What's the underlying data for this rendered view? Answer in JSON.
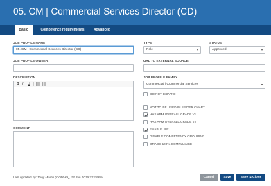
{
  "header": {
    "title": "05. CM | Commercial Services Director (CD)"
  },
  "tabs": [
    {
      "label": "Basic",
      "active": true
    },
    {
      "label": "Competence requirements",
      "active": false
    },
    {
      "label": "Advanced",
      "active": false
    }
  ],
  "form": {
    "job_profile_name": {
      "label": "JOB PROFILE NAME",
      "value": "05. CM | Commercial Services Director (CD)"
    },
    "type": {
      "label": "TYPE",
      "value": "Role"
    },
    "status": {
      "label": "STATUS",
      "value": "Approved"
    },
    "job_profile_owner": {
      "label": "JOB PROFILE OWNER",
      "value": ""
    },
    "url_external": {
      "label": "URL TO EXTERNAL SOURCE",
      "value": ""
    },
    "description": {
      "label": "DESCRIPTION"
    },
    "job_profile_family": {
      "label": "JOB PROFILE FAMILY",
      "value": "Commercial | Commercial Services"
    },
    "comment": {
      "label": "COMMENT"
    }
  },
  "editor_toolbar": {
    "bold": "B",
    "italic": "I",
    "underline": "U"
  },
  "checkboxes": [
    {
      "label": "DO NOT EXPAND",
      "checked": false
    },
    {
      "label": "NOT TO BE USED IN SPIDER CHART",
      "checked": false
    },
    {
      "label": "HAS APM OVERALL GRADE V1",
      "checked": true
    },
    {
      "label": "HAS APM OVERALL GRADE V2",
      "checked": false
    },
    {
      "label": "ENABLE JLR",
      "checked": true
    },
    {
      "label": "DISABLE COMPETENCY GROUPING",
      "checked": false
    },
    {
      "label": "GRADE 100% COMPLIANCE",
      "checked": false
    }
  ],
  "footer": {
    "last_updated_label": "Last updated by:",
    "last_updated_value": "Tony Martin (COMMA), 13 Jan 2019 22:18 PM",
    "cancel_label": "Cancel",
    "save_label": "Save",
    "save_close_label": "Save & Close"
  },
  "colors": {
    "header": "#2a6fb0",
    "tabbar": "#134a82",
    "primary_button": "#134a82",
    "cancel_button": "#8e959c"
  }
}
